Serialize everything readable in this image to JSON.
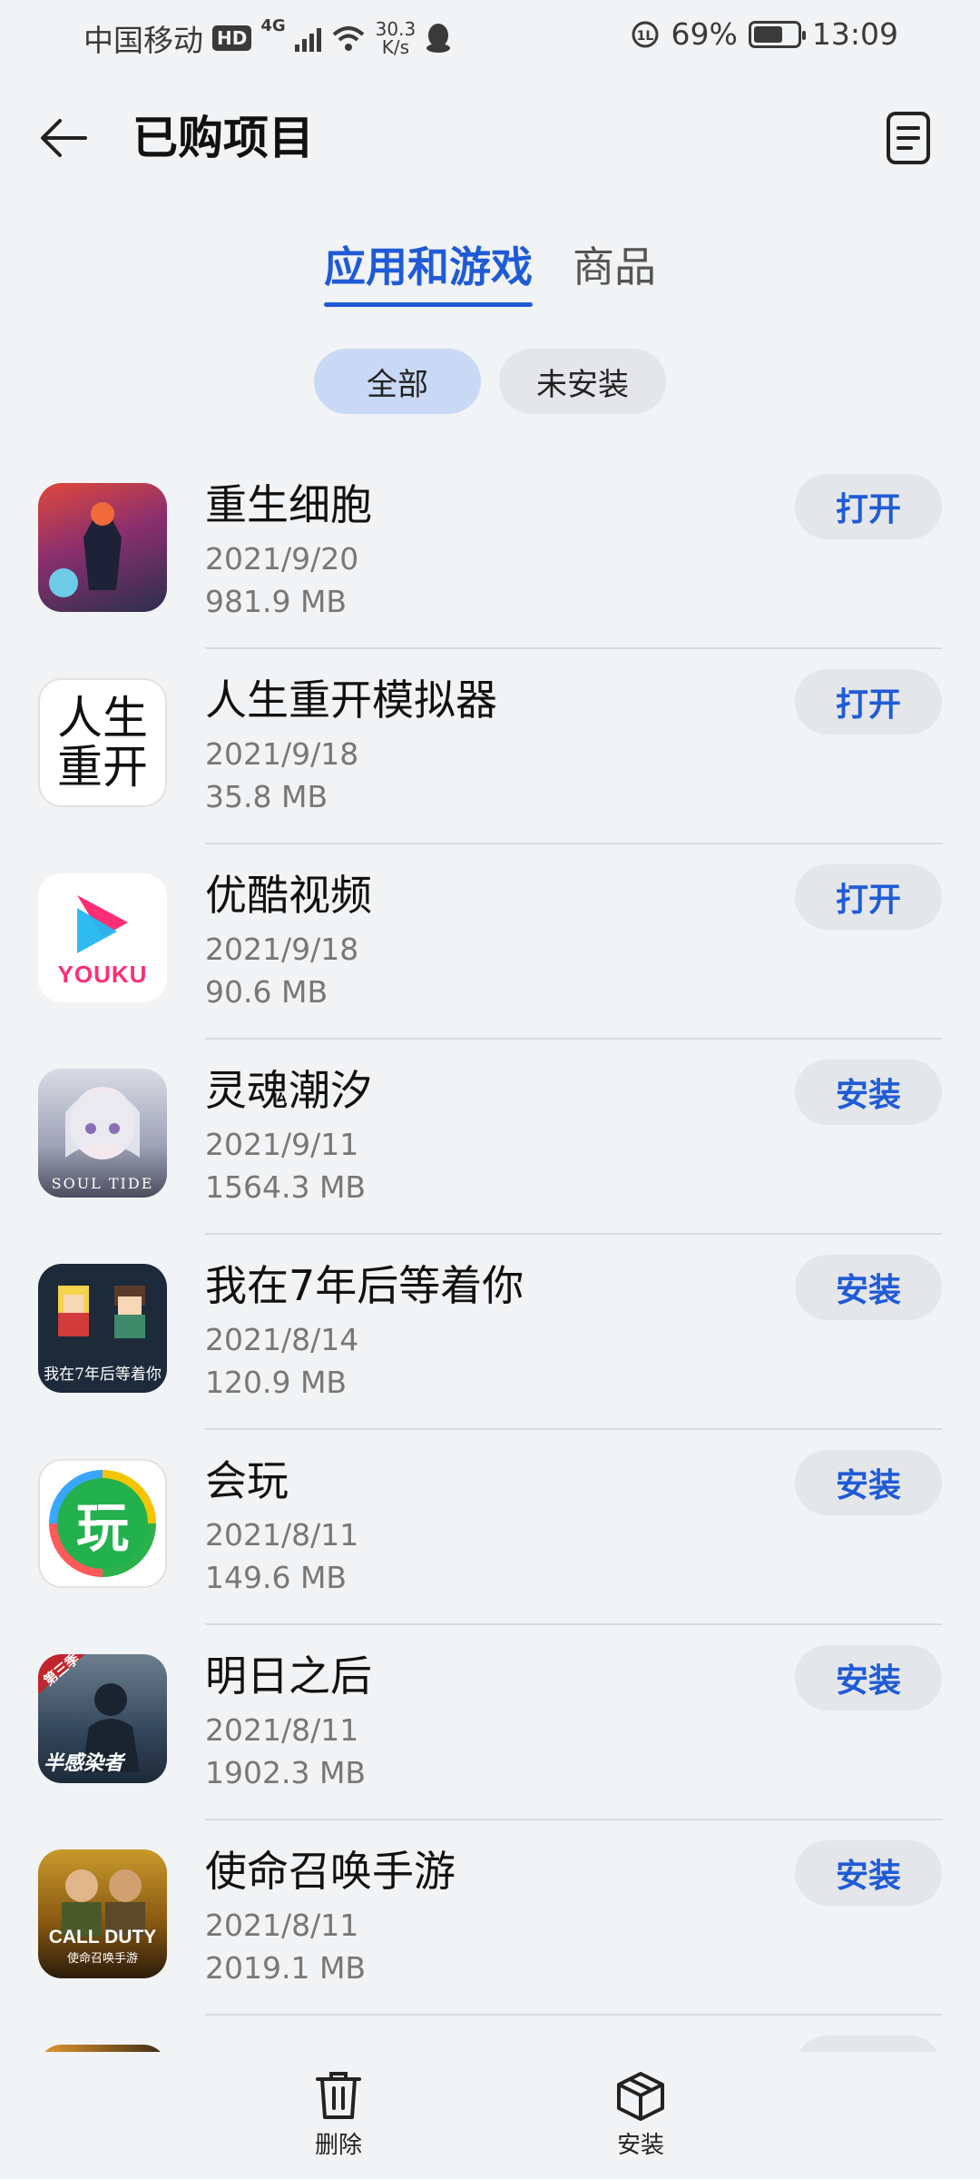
{
  "status_bar": {
    "carrier": "中国移动",
    "hd": "HD",
    "network": "4G",
    "speed_value": "30.3",
    "speed_unit": "K/s",
    "battery_percent": "69%",
    "battery_level": 0.69,
    "time": "13:09"
  },
  "header": {
    "title": "已购项目"
  },
  "tabs": [
    {
      "label": "应用和游戏",
      "active": true
    },
    {
      "label": "商品",
      "active": false
    }
  ],
  "filters": [
    {
      "label": "全部",
      "active": true
    },
    {
      "label": "未安装",
      "active": false
    }
  ],
  "apps": [
    {
      "name": "重生细胞",
      "date": "2021/9/20",
      "size": "981.9 MB",
      "action": "打开"
    },
    {
      "name": "人生重开模拟器",
      "date": "2021/9/18",
      "size": "35.8 MB",
      "action": "打开"
    },
    {
      "name": "优酷视频",
      "date": "2021/9/18",
      "size": "90.6 MB",
      "action": "打开"
    },
    {
      "name": "灵魂潮汐",
      "date": "2021/9/11",
      "size": "1564.3 MB",
      "action": "安装"
    },
    {
      "name": "我在7年后等着你",
      "date": "2021/8/14",
      "size": "120.9 MB",
      "action": "安装"
    },
    {
      "name": "会玩",
      "date": "2021/8/11",
      "size": "149.6 MB",
      "action": "安装"
    },
    {
      "name": "明日之后",
      "date": "2021/8/11",
      "size": "1902.3 MB",
      "action": "安装"
    },
    {
      "name": "使命召唤手游",
      "date": "2021/8/11",
      "size": "2019.1 MB",
      "action": "安装"
    }
  ],
  "icon_text": {
    "rensheng_line1": "人生",
    "rensheng_line2": "重开",
    "youku": "YOUKU",
    "soultide": "SOUL TIDE",
    "wozai": "我在7年后等着你",
    "huiwan": "玩",
    "mingri_badge": "第三季",
    "mingri": "半感染者",
    "cod": "CALL DUTY",
    "cod_sub": "使命召唤手游"
  },
  "bottom_bar": {
    "delete_label": "删除",
    "install_label": "安装"
  },
  "colors": {
    "accent": "#1f5bd6",
    "background": "#f1f3f5",
    "chip_active": "#c9d9f5",
    "button_bg": "#e4e6e9"
  }
}
